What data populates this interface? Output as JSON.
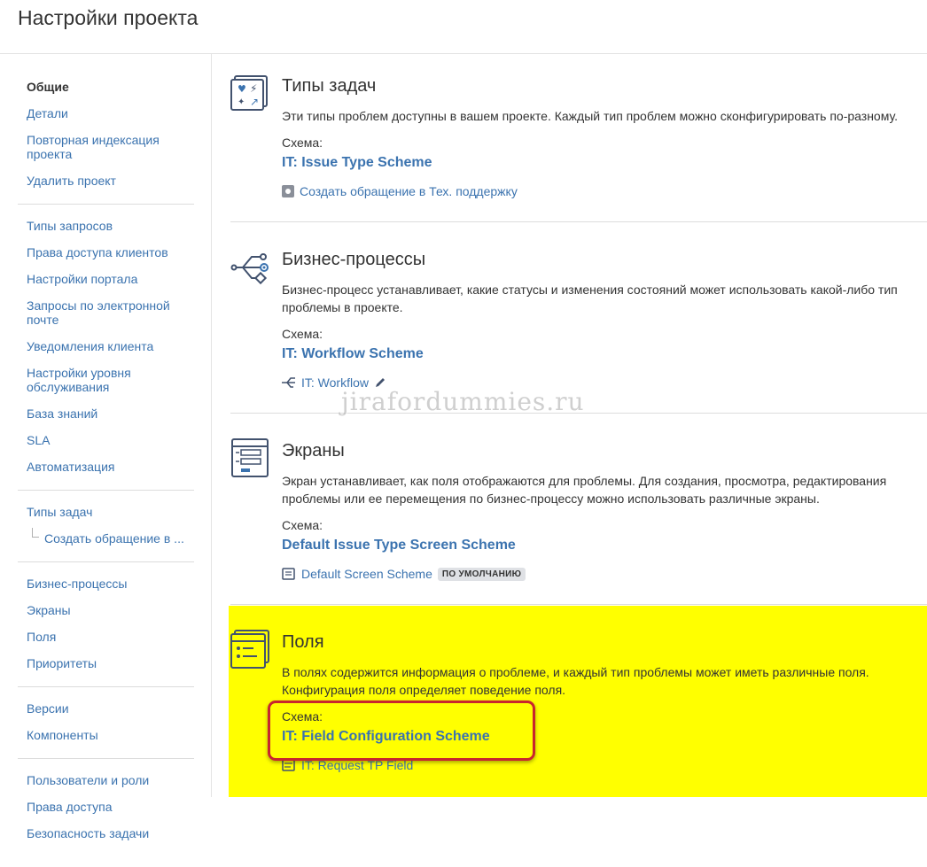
{
  "page": {
    "title": "Настройки проекта"
  },
  "sidebar": {
    "groups": [
      [
        "Общие",
        "Детали",
        "Повторная индексация проекта",
        "Удалить проект"
      ],
      [
        "Типы запросов",
        "Права доступа клиентов",
        "Настройки портала",
        "Запросы по электронной почте",
        "Уведомления клиента",
        "Настройки уровня обслуживания",
        "База знаний",
        "SLA",
        "Автоматизация"
      ],
      [
        "Типы задач",
        "Создать обращение в ..."
      ],
      [
        "Бизнес-процессы",
        "Экраны",
        "Поля",
        "Приоритеты"
      ],
      [
        "Версии",
        "Компоненты"
      ],
      [
        "Пользователи и роли",
        "Права доступа",
        "Безопасность задачи"
      ]
    ]
  },
  "sections": {
    "issue_types": {
      "title": "Типы задач",
      "desc": "Эти типы проблем доступны в вашем проекте. Каждый тип проблем можно сконфигурировать по-разному.",
      "label": "Схема:",
      "scheme": "IT: Issue Type Scheme",
      "meta": "Создать обращение в Тех. поддержку"
    },
    "workflows": {
      "title": "Бизнес-процессы",
      "desc": "Бизнес-процесс устанавливает, какие статусы и изменения состояний может использовать какой-либо тип проблемы в проекте.",
      "label": "Схема:",
      "scheme": "IT: Workflow Scheme",
      "meta": "IT: Workflow"
    },
    "screens": {
      "title": "Экраны",
      "desc": "Экран устанавливает, как поля отображаются для проблемы. Для создания, просмотра, редактирования проблемы или ее перемещения по бизнес-процессу можно использовать различные экраны.",
      "label": "Схема:",
      "scheme": "Default Issue Type Screen Scheme",
      "meta": "Default Screen Scheme",
      "badge": "ПО УМОЛЧАНИЮ"
    },
    "fields": {
      "title": "Поля",
      "desc": "В полях содержится информация о проблеме, и каждый тип проблемы может иметь различные поля. Конфигурация поля определяет поведение поля.",
      "label": "Схема:",
      "scheme": "IT: Field Configuration Scheme",
      "meta": "IT: Request TP Field"
    }
  },
  "watermark": "jirafordummies.ru",
  "colors": {
    "link": "#3b73af",
    "highlight": "#ffff00",
    "annotation": "#c8262e"
  }
}
